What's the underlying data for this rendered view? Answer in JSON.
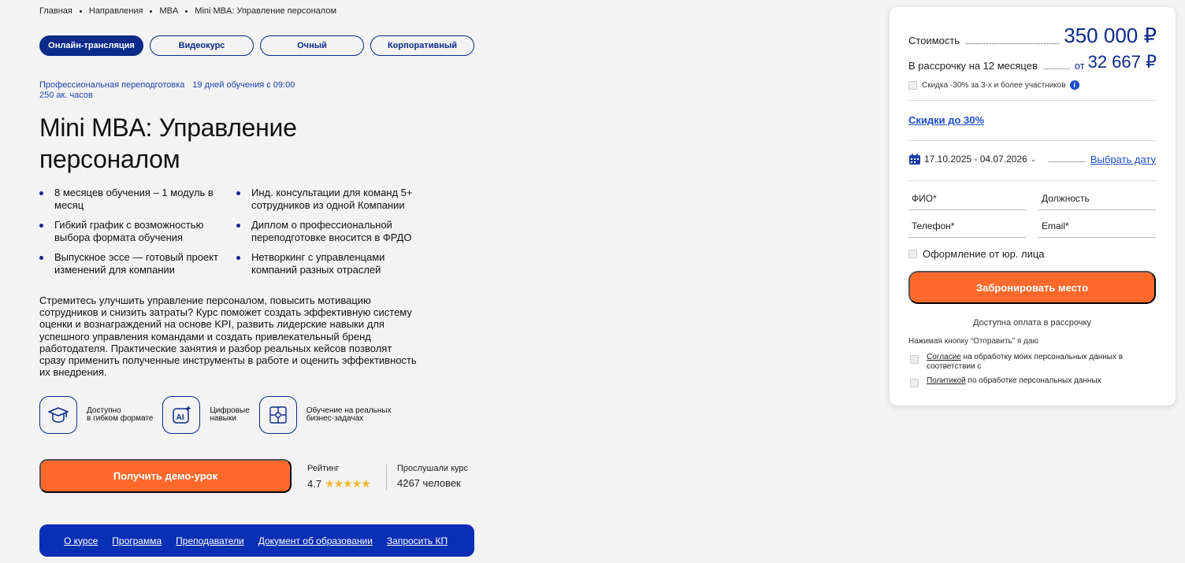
{
  "breadcrumb": [
    "Главная",
    "Направления",
    "MBA",
    "Mini MBA: Управление персоналом"
  ],
  "tabs": [
    {
      "label": "Онлайн-трансляция",
      "active": true
    },
    {
      "label": "Видеокурс",
      "active": false
    },
    {
      "label": "Очный",
      "active": false
    },
    {
      "label": "Корпоративный",
      "active": false
    }
  ],
  "meta": {
    "program_type": "Профессиональная переподготовка",
    "duration": "19 дней обучения с 09:00",
    "hours": "250 ак. часов"
  },
  "title": "Mini MBA: Управление персоналом",
  "features": [
    "8 месяцев обучения – 1 модуль в месяц",
    "Инд. консультации для команд 5+ сотрудников из одной Компании",
    "Гибкий график с возможностью выбора формата обучения",
    "Диплом о профессиональной переподготовке вносится в ФРДО",
    "Выпускное эссе — готовый проект изменений для компании",
    "Нетворкинг с управленцами компаний разных отраслей"
  ],
  "description": "Стремитесь улучшить управление персоналом, повысить мотивацию сотрудников и снизить затраты? Курс поможет создать эффективную систему оценки и вознаграждений на основе KPI, развить лидерские навыки для успешного управления командами и создать привлекательный бренд работодателя. Практические занятия и разбор реальных кейсов позволят сразу применить полученные инструменты в работе и оценить эффективность их внедрения.",
  "benefits": [
    {
      "icon": "graduation-cap-icon",
      "label": "Доступно\nв гибком формате"
    },
    {
      "icon": "ai-icon",
      "label": "Цифровые\nнавыки"
    },
    {
      "icon": "puzzle-icon",
      "label": "Обучение на реальных\nбизнес-задачах"
    }
  ],
  "demo_button": "Получить демо-урок",
  "rating": {
    "label": "Рейтинг",
    "value": "4.7",
    "stars": 5
  },
  "listened": {
    "label": "Прослушали курс",
    "value": "4267 человек"
  },
  "bottom_nav": [
    "О курсе",
    "Программа",
    "Преподаватели",
    "Документ об образовании",
    "Запросить КП"
  ],
  "panel": {
    "price_label": "Стоимость",
    "price": "350 000 ₽",
    "installment_label": "В рассрочку на 12 месяцев",
    "installment_from": "от",
    "installment_price": "32 667 ₽",
    "group_discount": "Скидка -30% за 3-х и более участников",
    "discount_link": "Скидки до 30%",
    "dates": "17.10.2025 - 04.07.2026",
    "choose_date": "Выбрать дату",
    "fields": {
      "name": "ФИО*",
      "position": "Должность",
      "phone": "Телефон*",
      "email": "Email*"
    },
    "legal_entity": "Оформление от юр. лица",
    "book_button": "Забронировать место",
    "installment_note": "Доступна оплата в рассрочку",
    "press_note": "Нажимая кнопку “Отправить” я даю",
    "consent1_link": "Согласие",
    "consent1_rest": " на обработку моих персональных данных в соответствии с",
    "consent2_link": "Политикой",
    "consent2_rest": " по обработке персональных данных"
  },
  "colors": {
    "brand_blue": "#0b2a8a",
    "accent_orange": "#ff6a2c",
    "nav_blue": "#0a2fb4",
    "link_blue": "#1d4fd1",
    "star": "#f2b733"
  }
}
